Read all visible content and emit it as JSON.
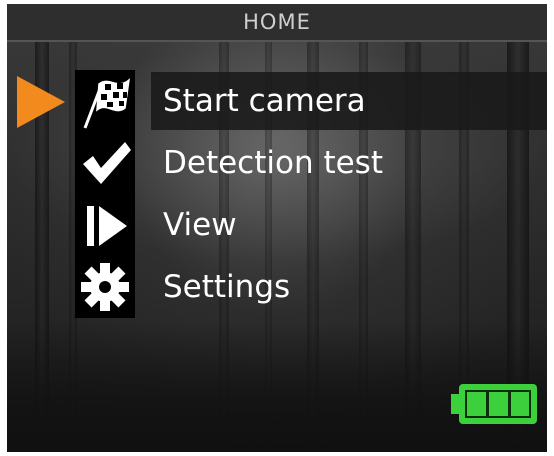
{
  "header": {
    "title": "HOME"
  },
  "menu": {
    "items": [
      {
        "label": "Start camera",
        "icon": "checkered-flag-icon",
        "selected": true
      },
      {
        "label": "Detection test",
        "icon": "checkmark-icon",
        "selected": false
      },
      {
        "label": "View",
        "icon": "play-icon",
        "selected": false
      },
      {
        "label": "Settings",
        "icon": "gear-icon",
        "selected": false
      }
    ]
  },
  "status": {
    "battery_level": 1.0,
    "battery_color": "#3cd03c"
  },
  "colors": {
    "pointer": "#f28a1e",
    "background": "#2a2a2a",
    "text": "#ffffff"
  }
}
